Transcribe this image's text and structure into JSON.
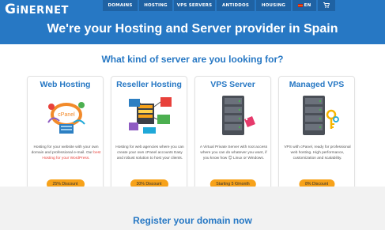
{
  "brand": {
    "logo_text": "GiNERNET"
  },
  "nav": {
    "items": [
      "DOMAINS",
      "HOSTING",
      "VPS SERVERS",
      "ANTIDDOS",
      "HOUSING",
      "EN",
      "🛒"
    ]
  },
  "hero": {
    "title": "We're your Hosting and Server provider in Spain"
  },
  "section": {
    "title": "What kind of server are you looking for?"
  },
  "cards": [
    {
      "title": "Web Hosting",
      "desc_pre": "Hosting for your website with your own domain and professional e-mail. Our ",
      "desc_link": "best Hosting for your WordPress.",
      "badge": "25% Discount"
    },
    {
      "title": "Reseller Hosting",
      "desc": "Hosting for web agencies where you can create your own cPanel accounts Easy and robust solution to host your clients.",
      "badge": "30% Discount"
    },
    {
      "title": "VPS Server",
      "desc": "A Virtual Private Server with root access where you can do whatever you want, if you know how 😊 Linux or Windows.",
      "badge": "Starting 5 €/month"
    },
    {
      "title": "Managed VPS",
      "desc": "VPS with cPanel, ready for professional web hosting. High performance, customization and scalability.",
      "badge": "8% Discount"
    }
  ],
  "register": {
    "title": "Register your domain now"
  },
  "colors": {
    "primary": "#2778c4",
    "nav_bg": "#1f62a3",
    "badge": "#f7a21a",
    "link": "#e8413b"
  }
}
